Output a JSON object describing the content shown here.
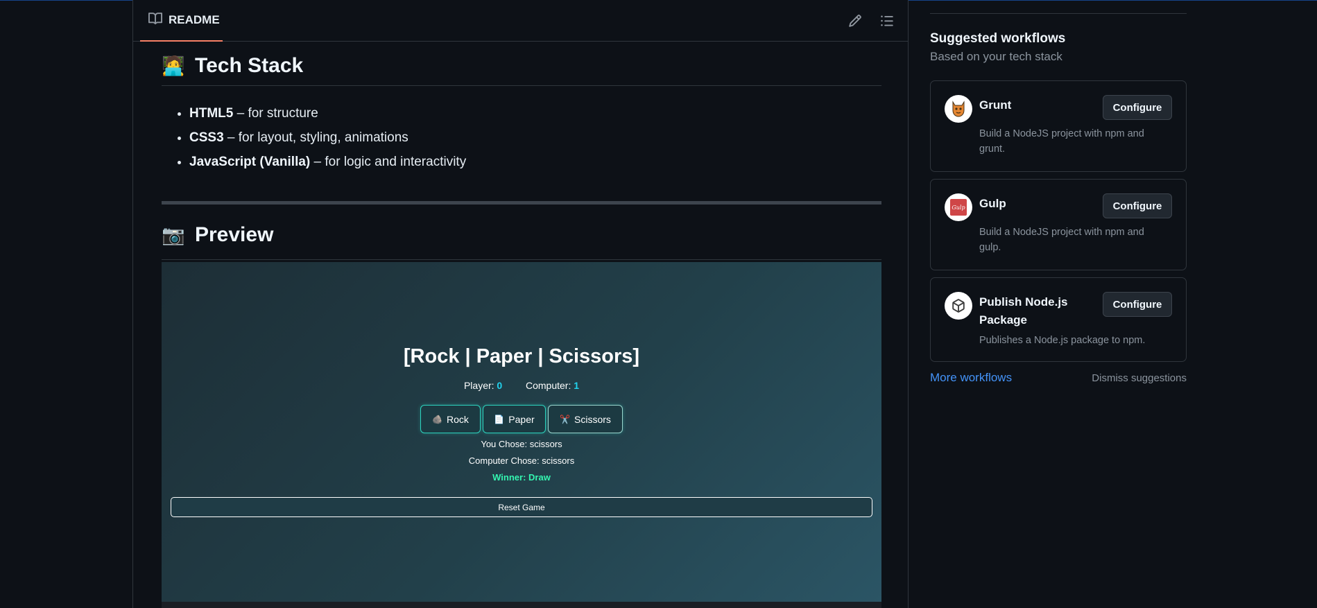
{
  "readme": {
    "tab_label": "README",
    "edit_icon": "pencil-icon",
    "toc_icon": "list-icon"
  },
  "tech_stack": {
    "emoji": "🧑‍💻",
    "heading": "Tech Stack",
    "items": [
      {
        "name": "HTML5",
        "desc": " – for structure"
      },
      {
        "name": "CSS3",
        "desc": " – for layout, styling, animations"
      },
      {
        "name": "JavaScript (Vanilla)",
        "desc": " – for logic and interactivity"
      }
    ]
  },
  "preview": {
    "emoji": "📷",
    "heading": "Preview"
  },
  "game": {
    "title": "[Rock | Paper | Scissors]",
    "player_label": "Player:",
    "player_score": "0",
    "computer_label": "Computer:",
    "computer_score": "1",
    "buttons": [
      {
        "icon": "🪨",
        "label": "Rock"
      },
      {
        "icon": "📄",
        "label": "Paper"
      },
      {
        "icon": "✂️",
        "label": "Scissors"
      }
    ],
    "you_chose": "You Chose: scissors",
    "computer_chose": "Computer Chose: scissors",
    "winner": "Winner: Draw",
    "reset_label": "Reset Game"
  },
  "sidebar": {
    "title": "Suggested workflows",
    "subtitle": "Based on your tech stack",
    "workflows": [
      {
        "name": "Grunt",
        "description": "Build a NodeJS project with npm and grunt.",
        "button": "Configure",
        "logo": "grunt-logo"
      },
      {
        "name": "Gulp",
        "description": "Build a NodeJS project with npm and gulp.",
        "button": "Configure",
        "logo": "gulp-logo"
      },
      {
        "name": "Publish Node.js Package",
        "description": "Publishes a Node.js package to npm.",
        "button": "Configure",
        "logo": "package-icon"
      }
    ],
    "more_link": "More workflows",
    "dismiss_link": "Dismiss suggestions"
  },
  "colors": {
    "background": "#0d1117",
    "tab_underline": "#f78166",
    "link": "#4493f8",
    "score_accent": "#22d3ee",
    "winner": "#34f5b0"
  }
}
